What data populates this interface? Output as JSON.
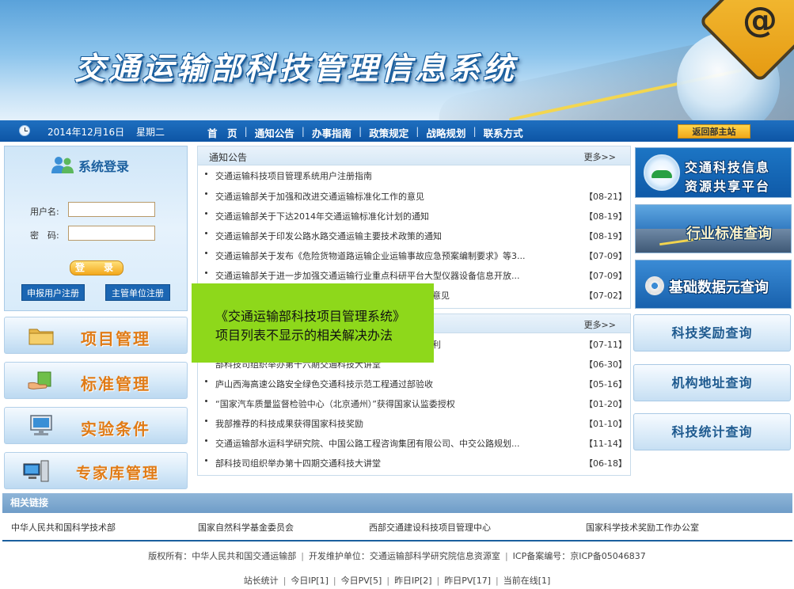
{
  "banner": {
    "title": "交通运输部科技管理信息系统"
  },
  "navbar": {
    "date": "2014年12月16日",
    "weekday": "星期二",
    "menu": [
      "首　页",
      "通知公告",
      "办事指南",
      "政策规定",
      "战略规划",
      "联系方式"
    ],
    "home_button": "返回部主站"
  },
  "login": {
    "title": "系统登录",
    "username_label": "用户名:",
    "password_label": "密　码:",
    "login_button": "登　录",
    "register_user_button": "申报用户注册",
    "register_unit_button": "主管单位注册"
  },
  "left_menu": [
    "项目管理",
    "标准管理",
    "实验条件",
    "专家库管理"
  ],
  "notices": {
    "title": "通知公告",
    "more": "更多>>",
    "items": [
      {
        "text": "交通运输科技项目管理系统用户注册指南",
        "date": ""
      },
      {
        "text": "交通运输部关于加强和改进交通运输标准化工作的意见",
        "date": "【08-21】"
      },
      {
        "text": "交通运输部关于下达2014年交通运输标准化计划的通知",
        "date": "【08-19】"
      },
      {
        "text": "交通运输部关于印发公路水路交通运输主要技术政策的通知",
        "date": "【08-19】"
      },
      {
        "text": "交通运输部关于发布《危险货物道路运输企业运输事故应急预案编制要求》等3...",
        "date": "【07-09】"
      },
      {
        "text": "交通运输部关于进一步加强交通运输行业重点科研平台大型仪器设备信息开放...",
        "date": "【07-09】"
      },
      {
        "text": "施意见",
        "date": "【07-02】"
      }
    ]
  },
  "news": {
    "more": "更多>>",
    "items": [
      {
        "text": "利",
        "date": "【07-11】"
      },
      {
        "text": "部科技司组织举办第十六期交通科技大讲堂",
        "date": "【06-30】"
      },
      {
        "text": "庐山西海高速公路安全绿色交通科技示范工程通过部验收",
        "date": "【05-16】"
      },
      {
        "text": "“国家汽车质量监督检验中心（北京通州）”获得国家认监委授权",
        "date": "【01-20】"
      },
      {
        "text": "我部推荐的科技成果获得国家科技奖励",
        "date": "【01-10】"
      },
      {
        "text": "交通运输部水运科学研究院、中国公路工程咨询集团有限公司、中交公路规划...",
        "date": "【11-14】"
      },
      {
        "text": "部科技司组织举办第十四期交通科技大讲堂",
        "date": "【06-18】"
      }
    ]
  },
  "tooltip": {
    "line1": "《交通运输部科技项目管理系统》",
    "line2": "项目列表不显示的相关解决办法"
  },
  "right_banners": {
    "info_platform_line1": "交通科技信息",
    "info_platform_line2": "资源共享平台",
    "standard_query": "行业标准查询",
    "basic_data_query": "基础数据元查询"
  },
  "right_queries": [
    "科技奖励查询",
    "机构地址查询",
    "科技统计查询"
  ],
  "links": {
    "title": "相关链接",
    "items": [
      "中华人民共和国科学技术部",
      "国家自然科学基金委员会",
      "西部交通建设科技项目管理中心",
      "国家科学技术奖励工作办公室"
    ]
  },
  "footer": {
    "copyright": "版权所有：中华人民共和国交通运输部",
    "maintainer": "开发维护单位：交通运输部科学研究院信息资源室",
    "icp": "ICP备案编号：京ICP备05046837",
    "stats": [
      "站长统计",
      "今日IP[1]",
      "今日PV[5]",
      "昨日IP[2]",
      "昨日PV[17]",
      "当前在线[1]"
    ]
  },
  "colors": {
    "nav_blue": "#0d55a5",
    "accent_orange": "#e07b16",
    "tooltip_green": "#8ed81b"
  }
}
